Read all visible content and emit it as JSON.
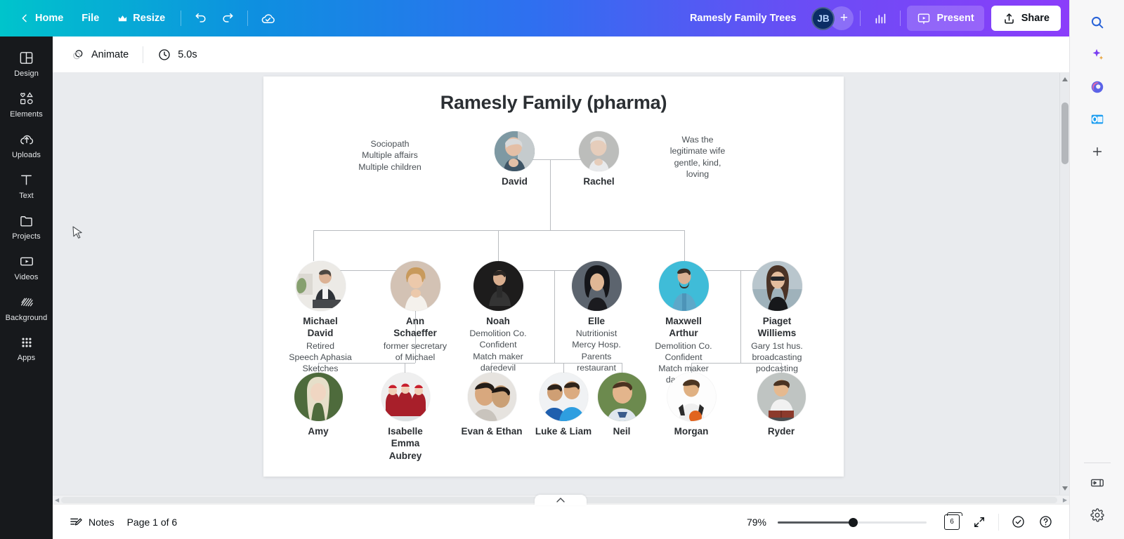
{
  "topbar": {
    "back_label": "",
    "home_label": "Home",
    "file_label": "File",
    "resize_label": "Resize",
    "undo_name": "undo",
    "redo_name": "redo",
    "cloud_status": "saved-to-cloud",
    "doc_title": "Ramesly Family Trees",
    "avatar_initials": "JB",
    "add_collaborator": "+",
    "insights_name": "insights",
    "present_label": "Present",
    "share_label": "Share",
    "gradient_start": "#00c4cc",
    "gradient_end": "#8b3dfa"
  },
  "subbar": {
    "animate_label": "Animate",
    "duration_label": "5.0s"
  },
  "sidebar": {
    "items": [
      {
        "label": "Design",
        "icon": "design-icon"
      },
      {
        "label": "Elements",
        "icon": "elements-icon"
      },
      {
        "label": "Uploads",
        "icon": "uploads-icon"
      },
      {
        "label": "Text",
        "icon": "text-icon"
      },
      {
        "label": "Projects",
        "icon": "projects-icon"
      },
      {
        "label": "Videos",
        "icon": "videos-icon"
      },
      {
        "label": "Background",
        "icon": "background-icon"
      },
      {
        "label": "Apps",
        "icon": "apps-icon"
      }
    ]
  },
  "canvas": {
    "title": "Ramesly Family (pharma)",
    "notes_left": "Sociopath\nMultiple affairs\nMultiple children",
    "notes_right": "Was the\nlegitimate wife\ngentle, kind,\nloving",
    "generation1": [
      {
        "name": "David",
        "desc": ""
      },
      {
        "name": "Rachel",
        "desc": ""
      }
    ],
    "generation2": [
      {
        "name": "Michael\nDavid",
        "desc": "Retired\nSpeech Aphasia\nSketches"
      },
      {
        "name": "Ann\nSchaeffer",
        "desc": "former secretary\nof Michael"
      },
      {
        "name": "Noah",
        "desc": "Demolition Co.\nConfident\nMatch maker\ndaredevil"
      },
      {
        "name": "Elle",
        "desc": "Nutritionist\nMercy Hosp.\nParents\nrestaurant"
      },
      {
        "name": "Maxwell\nArthur",
        "desc": "Demolition Co.\nConfident\nMatch maker\ndaredevil"
      },
      {
        "name": "Piaget\nWilliems",
        "desc": "Gary 1st hus.\nbroadcasting\npodcasting"
      }
    ],
    "generation3": [
      {
        "name": "Amy",
        "desc": ""
      },
      {
        "name": "Isabelle\nEmma\nAubrey",
        "desc": ""
      },
      {
        "name": "Evan & Ethan",
        "desc": ""
      },
      {
        "name": "Luke & Liam",
        "desc": ""
      },
      {
        "name": "Neil",
        "desc": ""
      },
      {
        "name": "Morgan",
        "desc": ""
      },
      {
        "name": "Ryder",
        "desc": ""
      }
    ]
  },
  "bottombar": {
    "notes_label": "Notes",
    "page_indicator": "Page 1 of 6",
    "zoom_level": "79%",
    "page_count_badge": "6",
    "fullscreen_name": "fullscreen",
    "help_name": "help",
    "status_name": "status-check"
  },
  "rail": {
    "items": [
      {
        "name": "search-icon"
      },
      {
        "name": "copilot-icon"
      },
      {
        "name": "microsoft365-icon"
      },
      {
        "name": "outlook-icon"
      },
      {
        "name": "add-tool-icon"
      }
    ],
    "bottom_items": [
      {
        "name": "sidebar-toggle-icon"
      },
      {
        "name": "settings-gear-icon"
      }
    ]
  }
}
